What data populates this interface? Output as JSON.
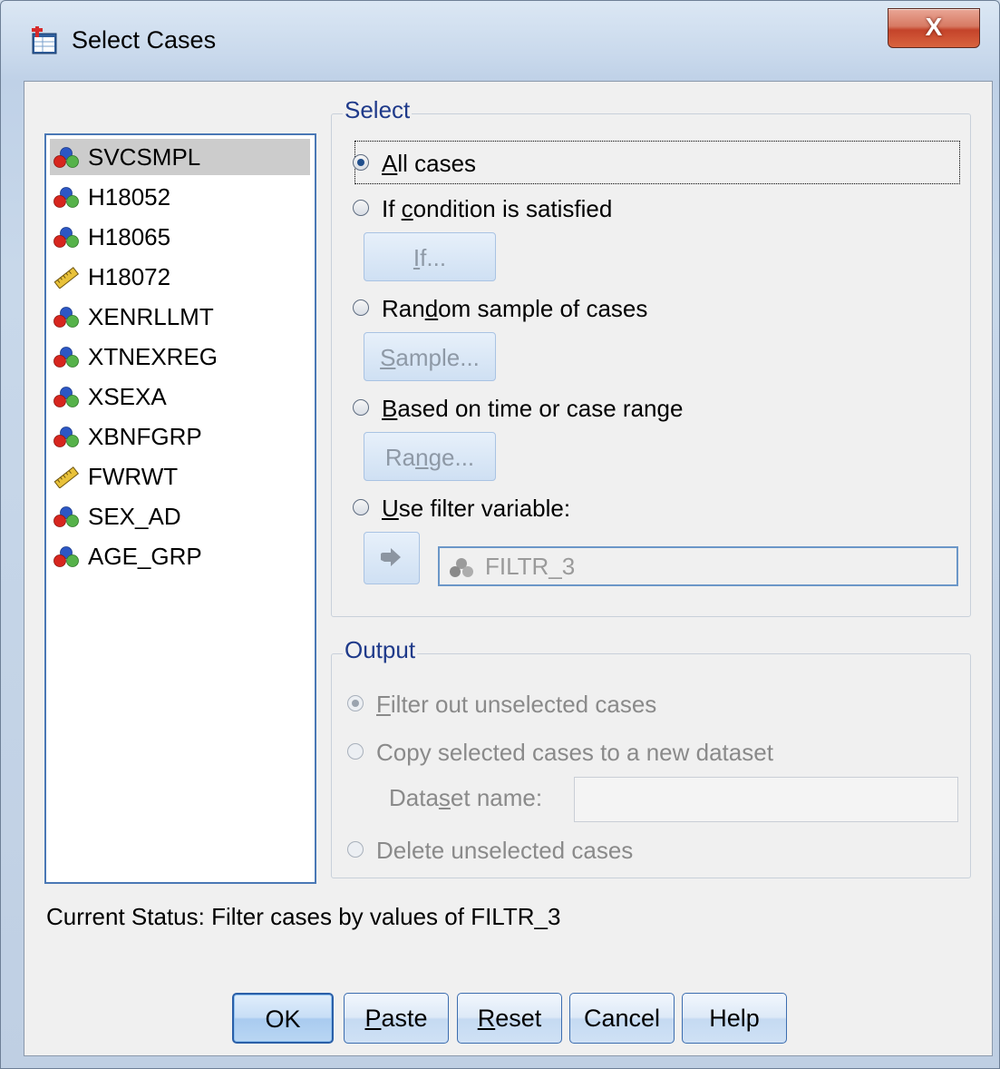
{
  "window": {
    "title": "Select Cases",
    "close_label": "X"
  },
  "variables": [
    {
      "name": "SVCSMPL",
      "icon": "nominal-icon",
      "selected": true
    },
    {
      "name": "H18052",
      "icon": "nominal-icon"
    },
    {
      "name": "H18065",
      "icon": "nominal-icon"
    },
    {
      "name": "H18072",
      "icon": "scale-ruler-icon"
    },
    {
      "name": "XENRLLMT",
      "icon": "nominal-icon"
    },
    {
      "name": "XTNEXREG",
      "icon": "nominal-icon"
    },
    {
      "name": "XSEXA",
      "icon": "nominal-icon"
    },
    {
      "name": "XBNFGRP",
      "icon": "nominal-icon"
    },
    {
      "name": "FWRWT",
      "icon": "scale-ruler-icon"
    },
    {
      "name": "SEX_AD",
      "icon": "nominal-icon"
    },
    {
      "name": "AGE_GRP",
      "icon": "nominal-icon"
    }
  ],
  "select": {
    "title": "Select",
    "options": {
      "all_cases": {
        "pre": "",
        "key": "A",
        "post": "ll cases",
        "checked": true
      },
      "if_condition": {
        "pre": "If ",
        "key": "c",
        "post": "ondition is satisfied"
      },
      "random": {
        "pre": "Ran",
        "key": "d",
        "post": "om sample of cases"
      },
      "time_range": {
        "pre": "",
        "key": "B",
        "post": "ased on time or case range"
      },
      "filter": {
        "pre": "",
        "key": "U",
        "post": "se filter variable:"
      }
    },
    "buttons": {
      "if": {
        "pre": "",
        "key": "I",
        "post": "f..."
      },
      "sample": {
        "pre": "",
        "key": "S",
        "post": "ample..."
      },
      "range": {
        "pre": "Ra",
        "key": "n",
        "post": "ge..."
      }
    },
    "filter_variable": "FILTR_3"
  },
  "output": {
    "title": "Output",
    "options": {
      "filter_out": {
        "pre": "",
        "key": "F",
        "post": "ilter out unselected cases",
        "checked": true
      },
      "copy": {
        "pre": "",
        "key": "",
        "post": "Copy selected cases to a new dataset"
      },
      "delete": {
        "pre": "",
        "key": "",
        "post": "Delete unselected cases"
      }
    },
    "dataset_name_label_pre": "Data",
    "dataset_name_label_key": "s",
    "dataset_name_label_post": "et name:",
    "dataset_name_value": ""
  },
  "status": "Current Status: Filter cases by values of FILTR_3",
  "buttons": {
    "ok": {
      "pre": "OK",
      "key": "",
      "post": ""
    },
    "paste": {
      "pre": "",
      "key": "P",
      "post": "aste"
    },
    "reset": {
      "pre": "",
      "key": "R",
      "post": "eset"
    },
    "cancel": {
      "pre": "Cancel",
      "key": "",
      "post": ""
    },
    "help": {
      "pre": "Help",
      "key": "",
      "post": ""
    }
  },
  "colors": {
    "group_title": "#1f3a8a",
    "list_border": "#4a78b5",
    "selection": "#cccccc",
    "close_button": "#c4432a"
  }
}
